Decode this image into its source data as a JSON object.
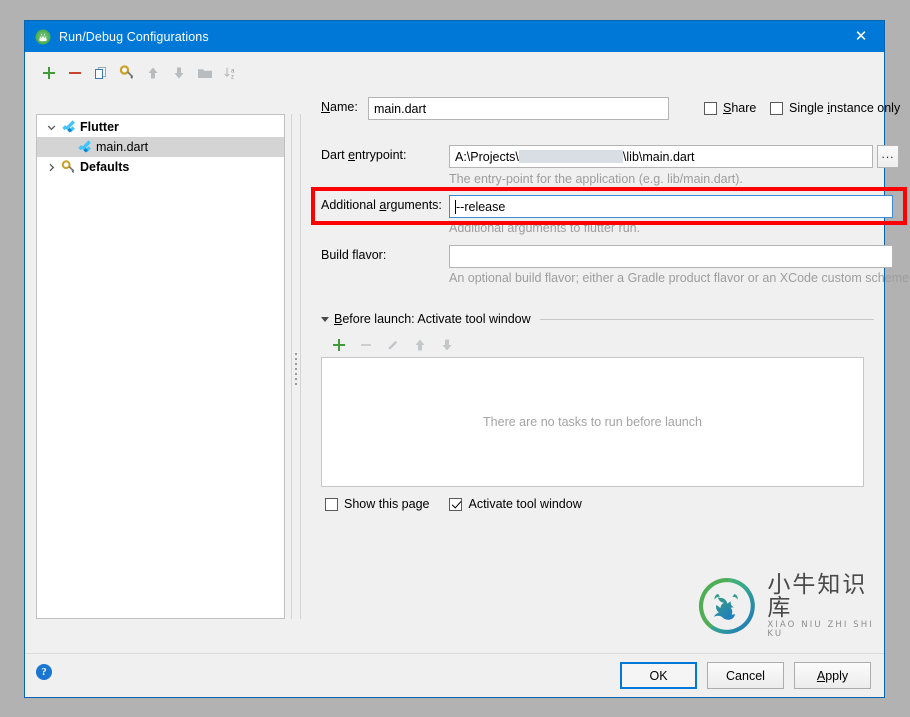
{
  "window": {
    "title": "Run/Debug Configurations",
    "icon": "android-studio-icon",
    "close_label": "✕"
  },
  "toolbar": {
    "buttons": [
      {
        "name": "add-configuration-button",
        "icon": "plus-icon",
        "label": "+"
      },
      {
        "name": "remove-configuration-button",
        "icon": "minus-icon",
        "label": "−"
      },
      {
        "name": "copy-configuration-button",
        "icon": "copy-icon",
        "label": ""
      },
      {
        "name": "edit-templates-button",
        "icon": "wrench-gear-icon",
        "label": ""
      },
      {
        "name": "move-up-button",
        "icon": "arrow-up-icon",
        "label": ""
      },
      {
        "name": "move-down-button",
        "icon": "arrow-down-icon",
        "label": ""
      },
      {
        "name": "move-into-folder-button",
        "icon": "folder-icon",
        "label": ""
      },
      {
        "name": "sort-configurations-button",
        "icon": "sort-az-icon",
        "label": ""
      }
    ]
  },
  "tree": {
    "nodes": [
      {
        "label": "Flutter",
        "icon": "flutter-icon",
        "arrow": "⌄",
        "expanded": true,
        "selected": false,
        "child": false
      },
      {
        "label": "main.dart",
        "icon": "flutter-icon",
        "arrow": "",
        "expanded": false,
        "selected": true,
        "child": true
      },
      {
        "label": "Defaults",
        "icon": "wrench-gear-icon",
        "arrow": "›",
        "expanded": false,
        "selected": false,
        "child": false
      }
    ]
  },
  "form": {
    "name_label": "Name:",
    "name_mnemonic": "N",
    "name_value": "main.dart",
    "share_label": "Share",
    "share_mnemonic": "S",
    "share_checked": false,
    "single_instance_label": "Single instance only",
    "single_instance_mnemonic": "i",
    "single_instance_checked": false,
    "entrypoint_label": "Dart entrypoint:",
    "entrypoint_mnemonic": "e",
    "entrypoint_prefix": "A:\\Projects\\",
    "entrypoint_suffix": "\\lib\\main.dart",
    "entrypoint_redacted": true,
    "browse_label": "...",
    "entrypoint_hint": "The entry-point for the application (e.g. lib/main.dart).",
    "additional_args_label": "Additional arguments:",
    "additional_args_mnemonic": "a",
    "additional_args_value": "--release",
    "additional_args_focused": true,
    "additional_args_hint": "Additional arguments to flutter run.",
    "build_flavor_label": "Build flavor:",
    "build_flavor_value": "",
    "build_flavor_hint": "An optional build flavor; either a Gradle product flavor or an XCode custom scheme."
  },
  "before_launch": {
    "title": "Before launch: Activate tool window",
    "title_mnemonic": "B",
    "expanded": true,
    "toolbar": [
      {
        "name": "add-task-button",
        "icon": "plus-icon"
      },
      {
        "name": "remove-task-button",
        "icon": "minus-icon"
      },
      {
        "name": "edit-task-button",
        "icon": "pencil-icon"
      },
      {
        "name": "move-task-up-button",
        "icon": "arrow-up-icon"
      },
      {
        "name": "move-task-down-button",
        "icon": "arrow-down-icon"
      }
    ],
    "empty_text": "There are no tasks to run before launch",
    "show_page_label": "Show this page",
    "show_page_checked": false,
    "activate_tool_window_label": "Activate tool window",
    "activate_tool_window_checked": true
  },
  "watermark": {
    "logo": "bull-circle-logo",
    "cn_text": "小牛知识库",
    "en_text": "XIAO NIU ZHI SHI KU"
  },
  "footer": {
    "help_label": "?",
    "ok_label": "OK",
    "cancel_label": "Cancel",
    "apply_label": "Apply",
    "apply_mnemonic": "A"
  },
  "colors": {
    "titlebar": "#0078d7",
    "highlight": "#ff0000",
    "accent": "#1976d2",
    "dialog_bg": "#f0f0f0",
    "desktop_bg": "#b2b2b2",
    "hint_text": "#9d9d9d"
  }
}
